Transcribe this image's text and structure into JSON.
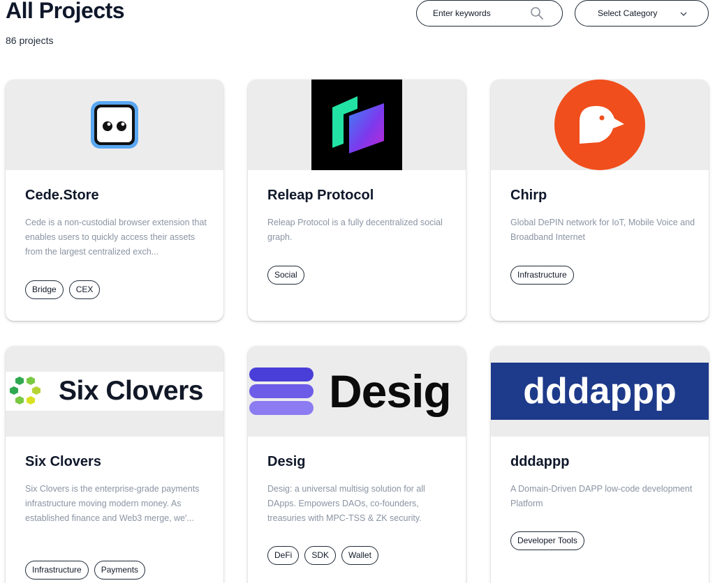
{
  "header": {
    "title": "All Projects",
    "count": "86 projects",
    "search_placeholder": "Enter keywords",
    "category_label": "Select Category",
    "search_icon": "search-icon",
    "chevron_icon": "chevron-down-icon"
  },
  "cards": [
    {
      "name": "Cede.Store",
      "description": "Cede is a non-custodial browser extension that enables users to quickly access their assets from the largest centralized exch...",
      "tags": [
        "Bridge",
        "CEX"
      ],
      "logo": "cede-store-logo"
    },
    {
      "name": "Releap Protocol",
      "description": "Releap Protocol is a fully decentralized social graph.",
      "tags": [
        "Social"
      ],
      "logo": "releap-logo"
    },
    {
      "name": "Chirp",
      "description": "Global DePIN network for IoT, Mobile Voice and Broadband Internet",
      "tags": [
        "Infrastructure"
      ],
      "logo": "chirp-logo"
    },
    {
      "name": "Six Clovers",
      "description": "Six Clovers is the enterprise-grade payments infrastructure moving modern money. As established finance and Web3 merge, we'...",
      "tags": [
        "Infrastructure",
        "Payments"
      ],
      "logo": "six-clovers-logo",
      "logo_text": "Six Clovers"
    },
    {
      "name": "Desig",
      "description": "Desig: a universal multisig solution for all DApps. Empowers DAOs, co-founders, treasuries with MPC-TSS & ZK security.",
      "tags": [
        "DeFi",
        "SDK",
        "Wallet"
      ],
      "logo": "desig-logo",
      "logo_text": "Desig"
    },
    {
      "name": "dddappp",
      "description": "A Domain-Driven DAPP low-code development Platform",
      "tags": [
        "Developer Tools"
      ],
      "logo": "dddappp-logo",
      "logo_text": "dddappp"
    }
  ],
  "colors": {
    "chirp_orange": "#f04e1c",
    "dddappp_blue": "#1e3a8a",
    "desig_purple": "#6d5ce8",
    "clover_green": "#7ac943"
  }
}
